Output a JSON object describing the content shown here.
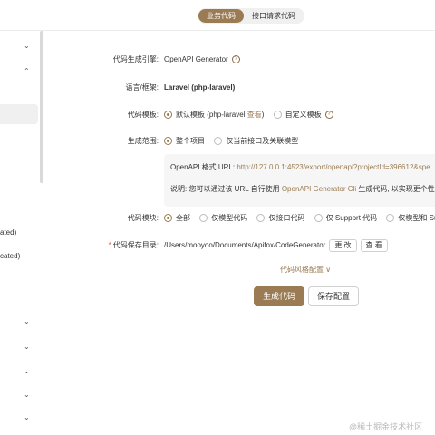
{
  "tabs": [
    {
      "label": "业务代码",
      "active": true
    },
    {
      "label": "接口请求代码",
      "active": false
    }
  ],
  "sidebar": {
    "items": [
      {
        "label": "ated)"
      },
      {
        "label": "cated)"
      }
    ]
  },
  "form": {
    "engine": {
      "label": "代码生成引擎:",
      "value": "OpenAPI Generator"
    },
    "language": {
      "label": "语言/框架:",
      "value": "Laravel (php-laravel)"
    },
    "template": {
      "label": "代码模板:",
      "default_text": "默认模板 (php-laravel ",
      "view_link": "查看",
      "default_close": ")",
      "custom": "自定义模板"
    },
    "scope": {
      "label": "生成范围:",
      "options": [
        "整个项目",
        "仅当前接口及关联模型"
      ]
    },
    "info": {
      "url_label": "OpenAPI 格式 URL: ",
      "url": "http://127.0.0.1:4523/export/openapi?projectId=396612&spe",
      "note_prefix": "说明: 您可以通过该 URL 自行使用 ",
      "note_link": "OpenAPI Generator Cli",
      "note_suffix": " 生成代码, 以实现更个性化"
    },
    "modules": {
      "label": "代码模块:",
      "options": [
        "全部",
        "仅模型代码",
        "仅接口代码",
        "仅 Support 代码",
        "仅模型和 Supp"
      ]
    },
    "save_dir": {
      "label": "代码保存目录:",
      "path": "/Users/mooyoo/Documents/Apifox/CodeGenerator",
      "change": "更 改",
      "view": "查 看"
    },
    "style_toggle": "代码风格配置 ∨"
  },
  "buttons": {
    "generate": "生成代码",
    "save": "保存配置"
  },
  "watermark": "@稀土掘金技术社区",
  "colors": {
    "accent": "#9a7b53",
    "required": "#e34d4d"
  }
}
